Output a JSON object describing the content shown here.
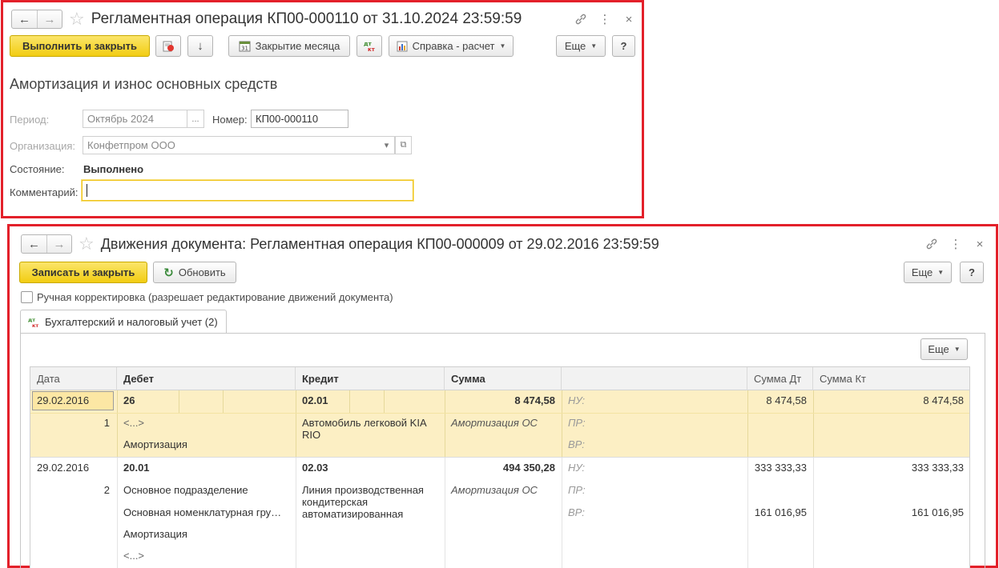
{
  "panel1": {
    "title": "Регламентная операция КП00-000110 от 31.10.2024 23:59:59",
    "toolbar": {
      "execute_close": "Выполнить и закрыть",
      "month_close": "Закрытие месяца",
      "help_calc": "Справка - расчет",
      "more": "Еще",
      "help": "?"
    },
    "heading": "Амортизация и износ основных средств",
    "form": {
      "period_label": "Период:",
      "period_value": "Октябрь 2024",
      "period_btn": "...",
      "number_label": "Номер:",
      "number_value": "КП00-000110",
      "org_label": "Организация:",
      "org_value": "Конфетпром ООО",
      "state_label": "Состояние:",
      "state_value": "Выполнено",
      "comment_label": "Комментарий:",
      "comment_value": ""
    }
  },
  "panel2": {
    "title": "Движения документа: Регламентная операция КП00-000009 от 29.02.2016 23:59:59",
    "toolbar": {
      "save_close": "Записать и закрыть",
      "refresh": "Обновить",
      "more": "Еще",
      "help": "?"
    },
    "manual_label": "Ручная корректировка (разрешает редактирование движений документа)",
    "tab_label": "Бухгалтерский и налоговый учет (2)",
    "grid_more": "Еще",
    "columns": [
      "Дата",
      "Дебет",
      "Кредит",
      "Сумма",
      "Сумма Дт",
      "Сумма Кт"
    ],
    "rows": [
      {
        "date": "29.02.2016",
        "num": "1",
        "debit": [
          "26",
          "<...>",
          "Амортизация"
        ],
        "credit": [
          "02.01",
          "Автомобиль легковой KIA",
          "RIO"
        ],
        "amount": "8 474,58",
        "content": "Амортизация ОС",
        "types": [
          "НУ:",
          "ПР:",
          "ВР:"
        ],
        "sum_dt": [
          "8 474,58",
          "",
          ""
        ],
        "sum_kt": [
          "8 474,58",
          "",
          ""
        ]
      },
      {
        "date": "29.02.2016",
        "num": "2",
        "debit": [
          "20.01",
          "Основное подразделение",
          "Основная номенклатурная гру…",
          "Амортизация",
          "<...>"
        ],
        "credit": [
          "02.03",
          "Линия производственная",
          "кондитерская",
          "автоматизированная"
        ],
        "amount": "494 350,28",
        "content": "Амортизация ОС",
        "types": [
          "НУ:",
          "ПР:",
          "ВР:"
        ],
        "sum_dt": [
          "333 333,33",
          "",
          "161 016,95"
        ],
        "sum_kt": [
          "333 333,33",
          "",
          "161 016,95"
        ]
      }
    ]
  }
}
